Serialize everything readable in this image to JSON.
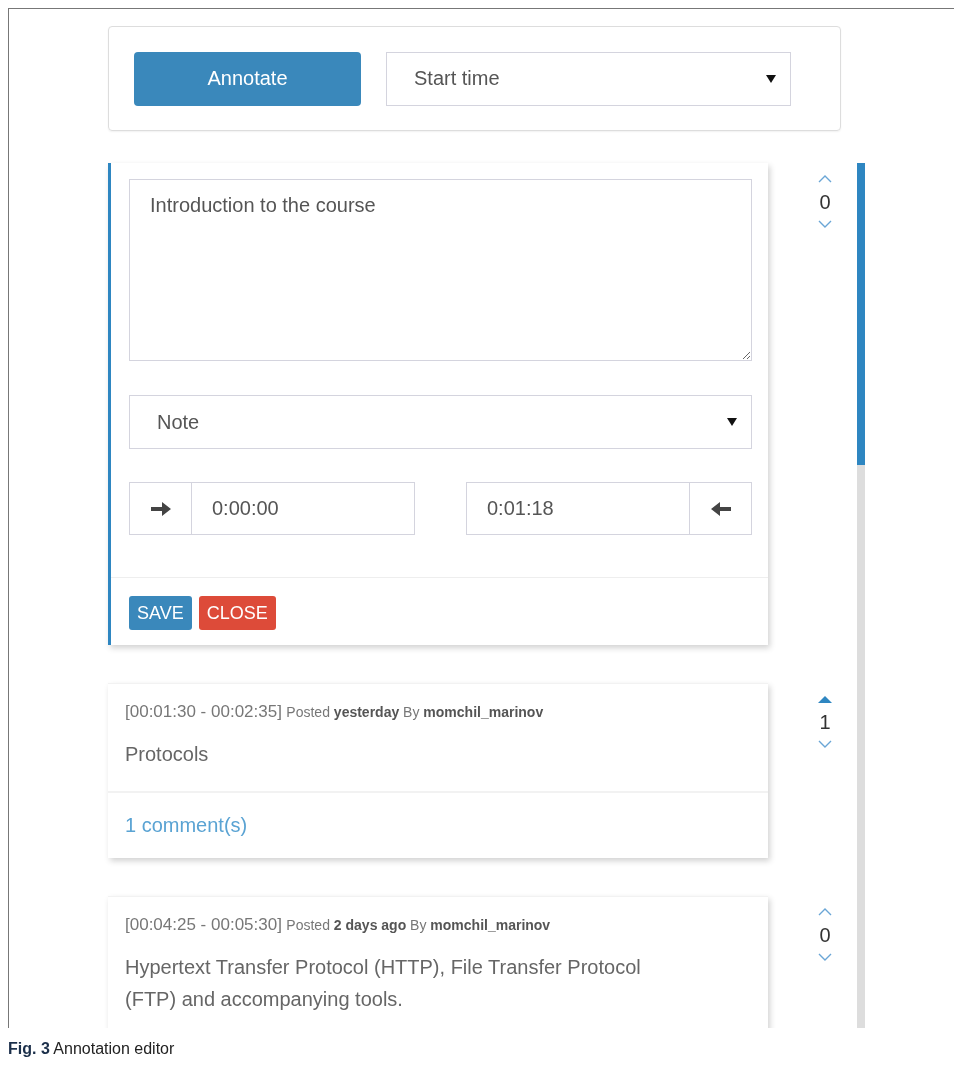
{
  "toolbar": {
    "annotate_button": "Annotate",
    "sort_select": {
      "value": "Start time"
    }
  },
  "editor": {
    "text": "Introduction to the course",
    "type_select": {
      "value": "Note"
    },
    "start_time": "0:00:00",
    "end_time": "0:01:18",
    "buttons": [
      {
        "label": "SAVE",
        "kind": "primary"
      },
      {
        "label": "CLOSE",
        "kind": "danger"
      }
    ],
    "votes": {
      "count": "0",
      "up_voted": false
    }
  },
  "annotations": [
    {
      "range": "[00:01:30 - 00:02:35]",
      "meta": "Posted **yesterday** By **momchil_marinov**",
      "text": "Protocols",
      "comments": "1 comment(s)",
      "votes": {
        "count": "1",
        "up_voted": true
      }
    },
    {
      "range": "[00:04:25 - 00:05:30]",
      "meta": "Posted **2 days ago** By **momchil_marinov**",
      "text": "Hypertext Transfer Protocol (HTTP), File Transfer Protocol (FTP) and accompanying tools.",
      "votes": {
        "count": "0",
        "up_voted": false
      }
    }
  ],
  "caption": "**Fig. 3** Annotation editor"
}
